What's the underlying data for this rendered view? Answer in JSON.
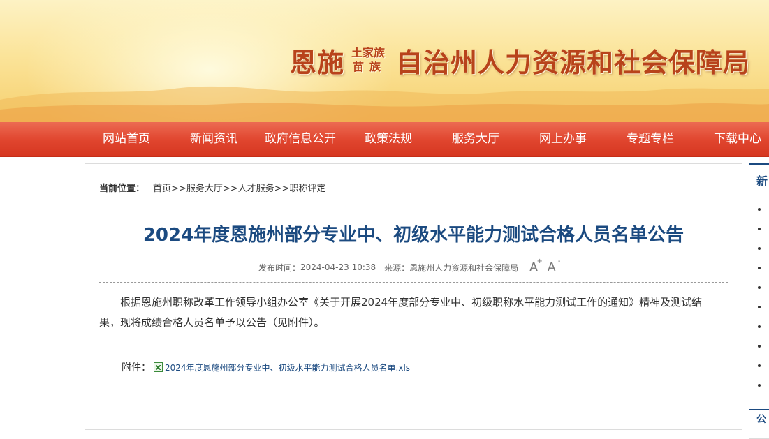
{
  "header": {
    "title_left": "恩施",
    "title_small_top": "土家族",
    "title_small_bottom": "苗族",
    "title_right": "自治州人力资源和社会保障局"
  },
  "nav": {
    "items": [
      "网站首页",
      "新闻资讯",
      "政府信息公开",
      "政策法规",
      "服务大厅",
      "网上办事",
      "专题专栏",
      "下载中心"
    ]
  },
  "breadcrumb": {
    "label": "当前位置：",
    "items": [
      "首页",
      "服务大厅",
      "人才服务",
      "职称评定"
    ],
    "separator": ">>"
  },
  "article": {
    "title": "2024年度恩施州部分专业中、初级水平能力测试合格人员名单公告",
    "publish_label": "发布时间：",
    "publish_time": "2024-04-23 10:38",
    "source_label": "来源：",
    "source": "恩施州人力资源和社会保障局",
    "font_increase": "A",
    "font_increase_sup": "+",
    "font_decrease": "A",
    "font_decrease_sup": "-",
    "body": "根据恩施州职称改革工作领导小组办公室《关于开展2024年度部分专业中、初级职称水平能力测试工作的通知》精神及测试结果，现将成绩合格人员名单予以公告（见附件）。",
    "attachment_label": "附件：",
    "attachment_name": "2024年度恩施州部分专业中、初级水平能力测试合格人员名单.xls"
  },
  "sidebar": {
    "title": "新",
    "bullet_count": 10,
    "second_title": "公"
  },
  "colors": {
    "nav_bg": "#e0452e",
    "title_blue": "#1b4a80",
    "banner_text": "#b8431b"
  },
  "icons": {
    "attachment": "xls-file-icon"
  }
}
